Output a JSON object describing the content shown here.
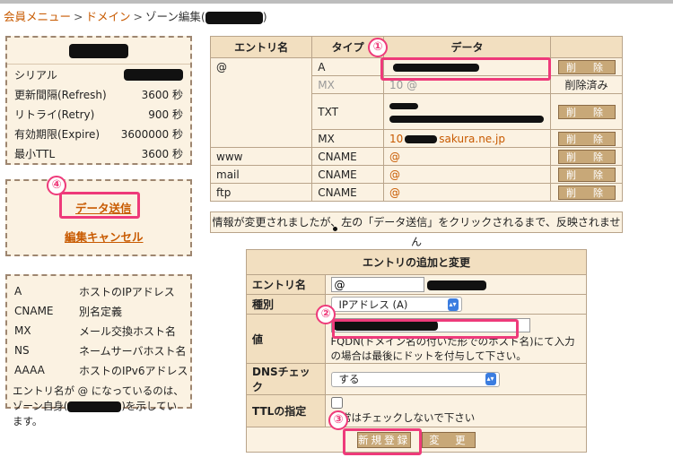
{
  "breadcrumb": {
    "member_menu": "会員メニュー",
    "domain": "ドメイン",
    "zone_edit": "ゾーン編集(",
    "close_paren": ")",
    "sep": ">"
  },
  "info": {
    "serial_label": "シリアル",
    "refresh_label": "更新間隔(Refresh)",
    "refresh_value": "3600 秒",
    "retry_label": "リトライ(Retry)",
    "retry_value": "900 秒",
    "expire_label": "有効期限(Expire)",
    "expire_value": "3600000 秒",
    "min_ttl_label": "最小TTL",
    "min_ttl_value": "3600 秒"
  },
  "actions": {
    "submit": "データ送信",
    "cancel": "編集キャンセル"
  },
  "legend": {
    "items": [
      {
        "type": "A",
        "desc": "ホストのIPアドレス"
      },
      {
        "type": "CNAME",
        "desc": "別名定義"
      },
      {
        "type": "MX",
        "desc": "メール交換ホスト名"
      },
      {
        "type": "NS",
        "desc": "ネームサーバホスト名"
      },
      {
        "type": "AAAA",
        "desc": "ホストのIPv6アドレス"
      }
    ],
    "note_a": "エントリ名が @ になっているのは、ゾーン自身(",
    "note_b": ")を示しています。"
  },
  "dns_table": {
    "headers": {
      "entry": "エントリ名",
      "type": "タイプ",
      "data": "データ"
    },
    "rows": [
      {
        "entry": "@",
        "type": "A",
        "data": "",
        "action": "削　除"
      },
      {
        "entry": "",
        "type": "MX",
        "data": "10 @",
        "action": "削除済み"
      },
      {
        "entry": "",
        "type": "TXT",
        "data": "",
        "action": "削　除"
      },
      {
        "entry": "",
        "type": "MX",
        "data_prefix": "10",
        "data_suffix": "sakura.ne.jp",
        "action": "削　除"
      },
      {
        "entry": "www",
        "type": "CNAME",
        "data": "@",
        "action": "削　除"
      },
      {
        "entry": "mail",
        "type": "CNAME",
        "data": "@",
        "action": "削　除"
      },
      {
        "entry": "ftp",
        "type": "CNAME",
        "data": "@",
        "action": "削　除"
      }
    ]
  },
  "notice": "情報が変更されましたが、左の「データ送信」をクリックされるまで、反映されません",
  "add_form": {
    "title": "エントリの追加と変更",
    "entry_label": "エントリ名",
    "entry_value": "@",
    "type_label": "種別",
    "type_value": "IPアドレス (A)",
    "value_label": "値",
    "value_help": "FQDN(ドメイン名の付いた形でのホスト名)にて入力の場合は最後にドットを付与して下さい。",
    "dns_label": "DNSチェック",
    "dns_value": "する",
    "ttl_label": "TTLの指定",
    "ttl_help": "通常はチェックしないで下さい",
    "new_button": "新規登録",
    "change_button": "変　更"
  },
  "markers": [
    "①",
    "②",
    "③",
    "④"
  ],
  "colors": {
    "highlight": "#ee3a7a",
    "link": "#c85a00",
    "panel_bg": "#fbf2e2",
    "header_bg": "#f2dfc0"
  }
}
